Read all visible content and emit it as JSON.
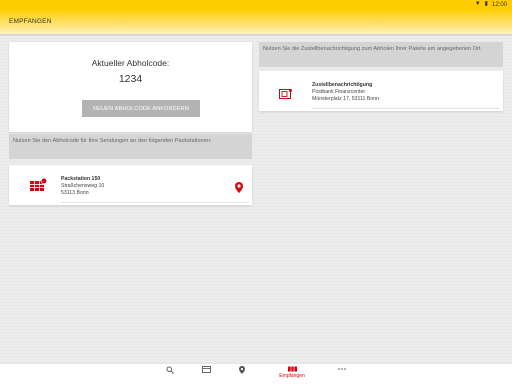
{
  "status_bar": {
    "time": "12:00"
  },
  "app_bar": {
    "title": "EMPFANGEN"
  },
  "pickup": {
    "label": "Aktueller Abholcode:",
    "code": "1234",
    "request_button": "NEUEN ABHOLCODE ANFORDERN"
  },
  "stations_info": "Nutzen Sie den Abholcode für Ihre Sendungen an den folgenden Packstationen:",
  "station": {
    "name": "Packstation 150",
    "street": "Straßchensweg 10",
    "city": "53113 Bonn"
  },
  "notice_info": "Nutzen Sie die Zustellbenachrichtigung zum Abholen Ihrer Pakete am angegebenen Ort.",
  "notice": {
    "title": "Zustellbenachrichtigung",
    "place": "Postbank Finanzcenter",
    "address": "Münsterplatz 17, 53111 Bonn"
  },
  "bottom_nav": {
    "items": [
      {
        "icon": "search-parcel-icon",
        "label": ""
      },
      {
        "icon": "parcel-box-icon",
        "label": ""
      },
      {
        "icon": "location-pin-icon",
        "label": ""
      },
      {
        "icon": "receive-icon",
        "label": "Empfangen"
      },
      {
        "icon": "more-icon",
        "label": ""
      }
    ],
    "active_color": "#d40511"
  },
  "colors": {
    "brand_yellow": "#ffcc00",
    "brand_red": "#d40511"
  }
}
